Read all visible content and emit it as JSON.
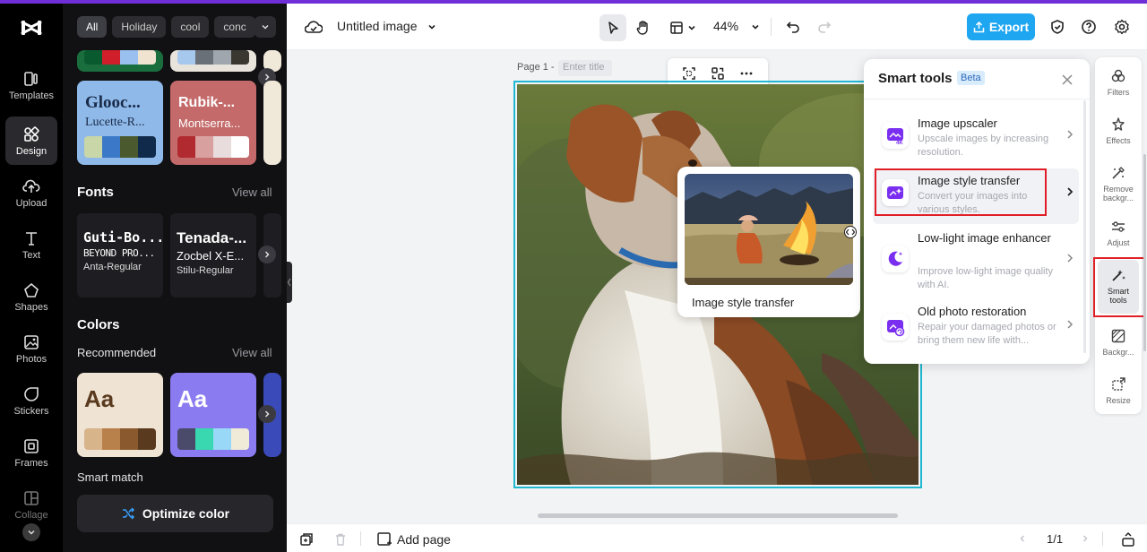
{
  "app": {
    "name": "CapCut",
    "accent": "#6f2fd8"
  },
  "rail": {
    "items": [
      {
        "label": "Templates",
        "icon": "templates-icon"
      },
      {
        "label": "Design",
        "icon": "design-icon",
        "active": true
      },
      {
        "label": "Upload",
        "icon": "upload-icon"
      },
      {
        "label": "Text",
        "icon": "text-icon"
      },
      {
        "label": "Shapes",
        "icon": "shapes-icon"
      },
      {
        "label": "Photos",
        "icon": "photos-icon"
      },
      {
        "label": "Stickers",
        "icon": "stickers-icon"
      },
      {
        "label": "Frames",
        "icon": "frames-icon"
      },
      {
        "label": "Collage",
        "icon": "collage-icon"
      }
    ]
  },
  "panel": {
    "chips": [
      "All",
      "Holiday",
      "cool",
      "conc"
    ],
    "style_cards": [
      {
        "title": "Glooc...",
        "subtitle": "Lucette-R...",
        "bg": "#8fb9e8",
        "text_color": "#1a2b4a",
        "swatches": [
          "#c9d6a8",
          "#3b78c7",
          "#4a5a2e",
          "#0f2a4a"
        ]
      },
      {
        "title": "Rubik-...",
        "subtitle": "Montserra...",
        "bg": "#c46a6a",
        "text_color": "#ffffff",
        "swatches": [
          "#b02a30",
          "#d9a0a0",
          "#e8dcdc",
          "#ffffff"
        ]
      }
    ],
    "fonts": {
      "title": "Fonts",
      "view_all": "View all",
      "cards": [
        {
          "big": "Guti-Bo...",
          "mid": "BEYOND PRO...",
          "small": "Anta-Regular"
        },
        {
          "big": "Tenada-...",
          "mid": "Zocbel X-E...",
          "small": "Stilu-Regular"
        }
      ]
    },
    "colors": {
      "title": "Colors",
      "recommended": "Recommended",
      "view_all": "View all",
      "cards": [
        {
          "sample": "Aa",
          "bg": "#efe3d3",
          "text_color": "#5a3a1e",
          "swatches": [
            "#d8b48a",
            "#b8804a",
            "#8a5a2e",
            "#5a3a1e"
          ]
        },
        {
          "sample": "Aa",
          "bg": "#8a7cf0",
          "text_color": "#ffffff",
          "swatches": [
            "#4a4a6a",
            "#3ad8b0",
            "#9ad8f8",
            "#f0ead8"
          ]
        }
      ]
    },
    "smart_match": "Smart match",
    "optimize_label": "Optimize color"
  },
  "header": {
    "doc_title": "Untitled image",
    "zoom": "44%",
    "export_label": "Export"
  },
  "canvas": {
    "page_label": "Page 1 -",
    "title_placeholder": "Enter title",
    "preview_label": "Image style transfer"
  },
  "smart_tools": {
    "title": "Smart tools",
    "badge": "Beta",
    "items": [
      {
        "name": "Image upscaler",
        "desc": "Upscale images by increasing resolution.",
        "icon": "upscaler-4k-icon"
      },
      {
        "name": "Image style transfer",
        "desc": "Convert your images into various styles.",
        "icon": "style-transfer-icon"
      },
      {
        "name": "Low-light image enhancer",
        "desc": "Improve low-light image quality with AI.",
        "icon": "low-light-icon"
      },
      {
        "name": "Old photo restoration",
        "desc": "Repair your damaged photos or bring them new life with...",
        "icon": "photo-restoration-icon"
      }
    ]
  },
  "right_rail": {
    "items": [
      {
        "label": "Filters",
        "icon": "filters-icon"
      },
      {
        "label": "Effects",
        "icon": "effects-icon"
      },
      {
        "label": "Remove backgr...",
        "icon": "remove-background-icon"
      },
      {
        "label": "Adjust",
        "icon": "adjust-icon"
      },
      {
        "label": "Smart tools",
        "icon": "smart-tools-icon",
        "active": true
      },
      {
        "label": "Backgr...",
        "icon": "background-icon"
      },
      {
        "label": "Resize",
        "icon": "resize-icon"
      }
    ]
  },
  "bottom": {
    "add_page": "Add page",
    "page_count": "1/1"
  }
}
